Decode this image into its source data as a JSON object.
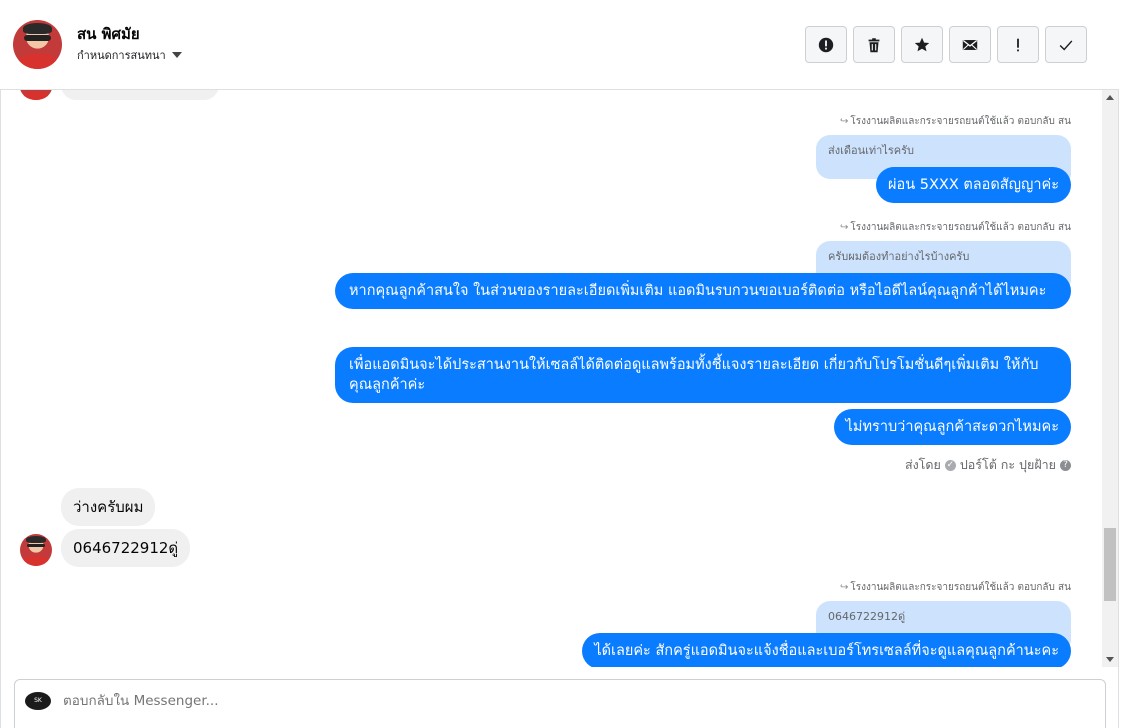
{
  "header": {
    "name": "สน พิศมัย",
    "subtitle": "กำหนดการสนทนา",
    "actions": [
      {
        "name": "mark-spam-button",
        "glyph": "!",
        "icon": "alert-circle-icon"
      },
      {
        "name": "delete-button",
        "glyph": "",
        "icon": "trash-icon"
      },
      {
        "name": "star-button",
        "glyph": "★",
        "icon": "star-icon"
      },
      {
        "name": "mark-unread-button",
        "glyph": "✉",
        "icon": "envelope-icon"
      },
      {
        "name": "follow-up-button",
        "glyph": "!",
        "icon": "exclamation-icon"
      },
      {
        "name": "mark-done-button",
        "glyph": "✓",
        "icon": "check-icon"
      }
    ]
  },
  "messages": {
    "reply_meta_1": "โรงงานผลิตและกระจายรถยนต์ใช้แล้ว ตอบกลับ สน",
    "quoted_1": "ส่งเดือนเท่าไรครับ",
    "out_1": "ผ่อน 5XXX ตลอดสัญญาค่ะ",
    "reply_meta_2": "โรงงานผลิตและกระจายรถยนต์ใช้แล้ว ตอบกลับ สน",
    "quoted_2": "ครับผมต้องทำอย่างไรบ้างครับ",
    "out_2": "หากคุณลูกค้าสนใจ ในส่วนของรายละเอียดเพิ่มเติม แอดมินรบกวนขอเบอร์ติดต่อ หรือไอดีไลน์คุณลูกค้าได้ไหมคะ",
    "out_3": "เพื่อแอดมินจะได้ประสานงานให้เซลล์ได้ติดต่อดูแลพร้อมทั้งชี้แจงรายละเอียด เกี่ยวกับโปรโมชั่นดีๆเพิ่มเติม ให้กับคุณลูกค้าค่ะ",
    "out_4": "ไม่ทราบว่าคุณลูกค้าสะดวกไหมคะ",
    "sent_by_label": "ส่งโดย",
    "sent_by_name": "ปอร์โต้ กะ ปุยฝ้าย",
    "in_1": "ว่างครับผม",
    "in_2": "0646722912ดู่",
    "reply_meta_3": "โรงงานผลิตและกระจายรถยนต์ใช้แล้ว ตอบกลับ สน",
    "quoted_3": "0646722912ดู่",
    "out_5": "ได้เลยค่ะ สักครู่แอดมินจะแจ้งชื่อและเบอร์โทรเซลล์ที่จะดูแลคุณลูกค้านะคะ"
  },
  "composer": {
    "placeholder": "ตอบกลับใน Messenger...",
    "page_logo_text": "SK"
  }
}
